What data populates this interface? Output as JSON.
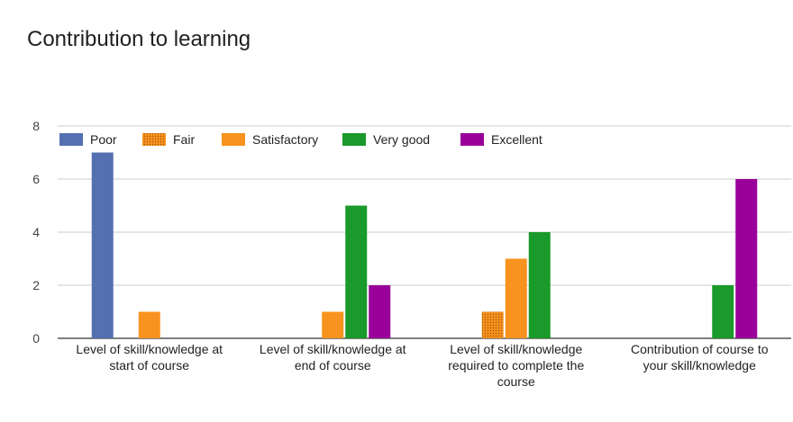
{
  "title": "Contribution to learning",
  "chart_data": {
    "type": "bar",
    "title": "Contribution to learning",
    "categories": [
      [
        "Level of skill/knowledge at",
        "start of course"
      ],
      [
        "Level of skill/knowledge at",
        "end of course"
      ],
      [
        "Level of skill/knowledge",
        "required to complete the",
        "course"
      ],
      [
        "Contribution of course to",
        "your skill/knowledge"
      ]
    ],
    "series": [
      {
        "name": "Poor",
        "color": "#5470b0",
        "pattern": "solid",
        "values": [
          7,
          0,
          0,
          0
        ]
      },
      {
        "name": "Fair",
        "color": "#f39c1b",
        "pattern": "dotted",
        "values": [
          0,
          0,
          1,
          0
        ]
      },
      {
        "name": "Satisfactory",
        "color": "#f7931e",
        "pattern": "solid",
        "values": [
          1,
          1,
          3,
          0
        ]
      },
      {
        "name": "Very good",
        "color": "#1a9a2a",
        "pattern": "solid",
        "values": [
          0,
          5,
          4,
          2
        ]
      },
      {
        "name": "Excellent",
        "color": "#990099",
        "pattern": "solid",
        "values": [
          0,
          2,
          0,
          6
        ]
      }
    ],
    "yticks": [
      "0",
      "2",
      "4",
      "6",
      "8"
    ],
    "ylim": [
      0,
      8
    ],
    "grid": true,
    "legend_position": "top-left"
  }
}
